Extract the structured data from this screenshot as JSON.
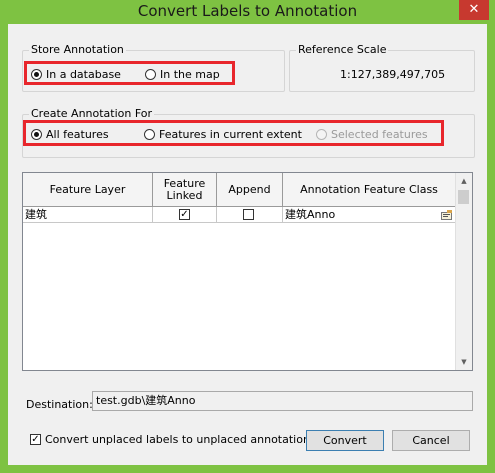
{
  "window": {
    "title": "Convert Labels to Annotation",
    "close_glyph": "✕"
  },
  "store_annotation": {
    "title": "Store Annotation",
    "options": [
      {
        "label": "In a database",
        "selected": true
      },
      {
        "label": "In the map",
        "selected": false
      }
    ]
  },
  "reference_scale": {
    "title": "Reference Scale",
    "value": "1:127,389,497,705"
  },
  "create_annotation_for": {
    "title": "Create Annotation For",
    "options": [
      {
        "label": "All features",
        "selected": true,
        "enabled": true
      },
      {
        "label": "Features in current extent",
        "selected": false,
        "enabled": true
      },
      {
        "label": "Selected features",
        "selected": false,
        "enabled": false
      }
    ]
  },
  "grid": {
    "headers": {
      "feature_layer": "Feature Layer",
      "feature_linked": "Feature Linked",
      "append": "Append",
      "annotation_class": "Annotation Feature Class"
    },
    "rows": [
      {
        "feature_layer": "建筑",
        "feature_linked": true,
        "append": false,
        "annotation_class": "建筑Anno"
      }
    ]
  },
  "destination": {
    "label": "Destination:",
    "value": "test.gdb\\建筑Anno"
  },
  "convert_unplaced": {
    "label": "Convert unplaced labels to unplaced annotation",
    "checked": true
  },
  "buttons": {
    "convert": "Convert",
    "cancel": "Cancel"
  },
  "colors": {
    "frame": "#7ec242",
    "highlight": "#e8262c",
    "close_button": "#c7392f"
  }
}
